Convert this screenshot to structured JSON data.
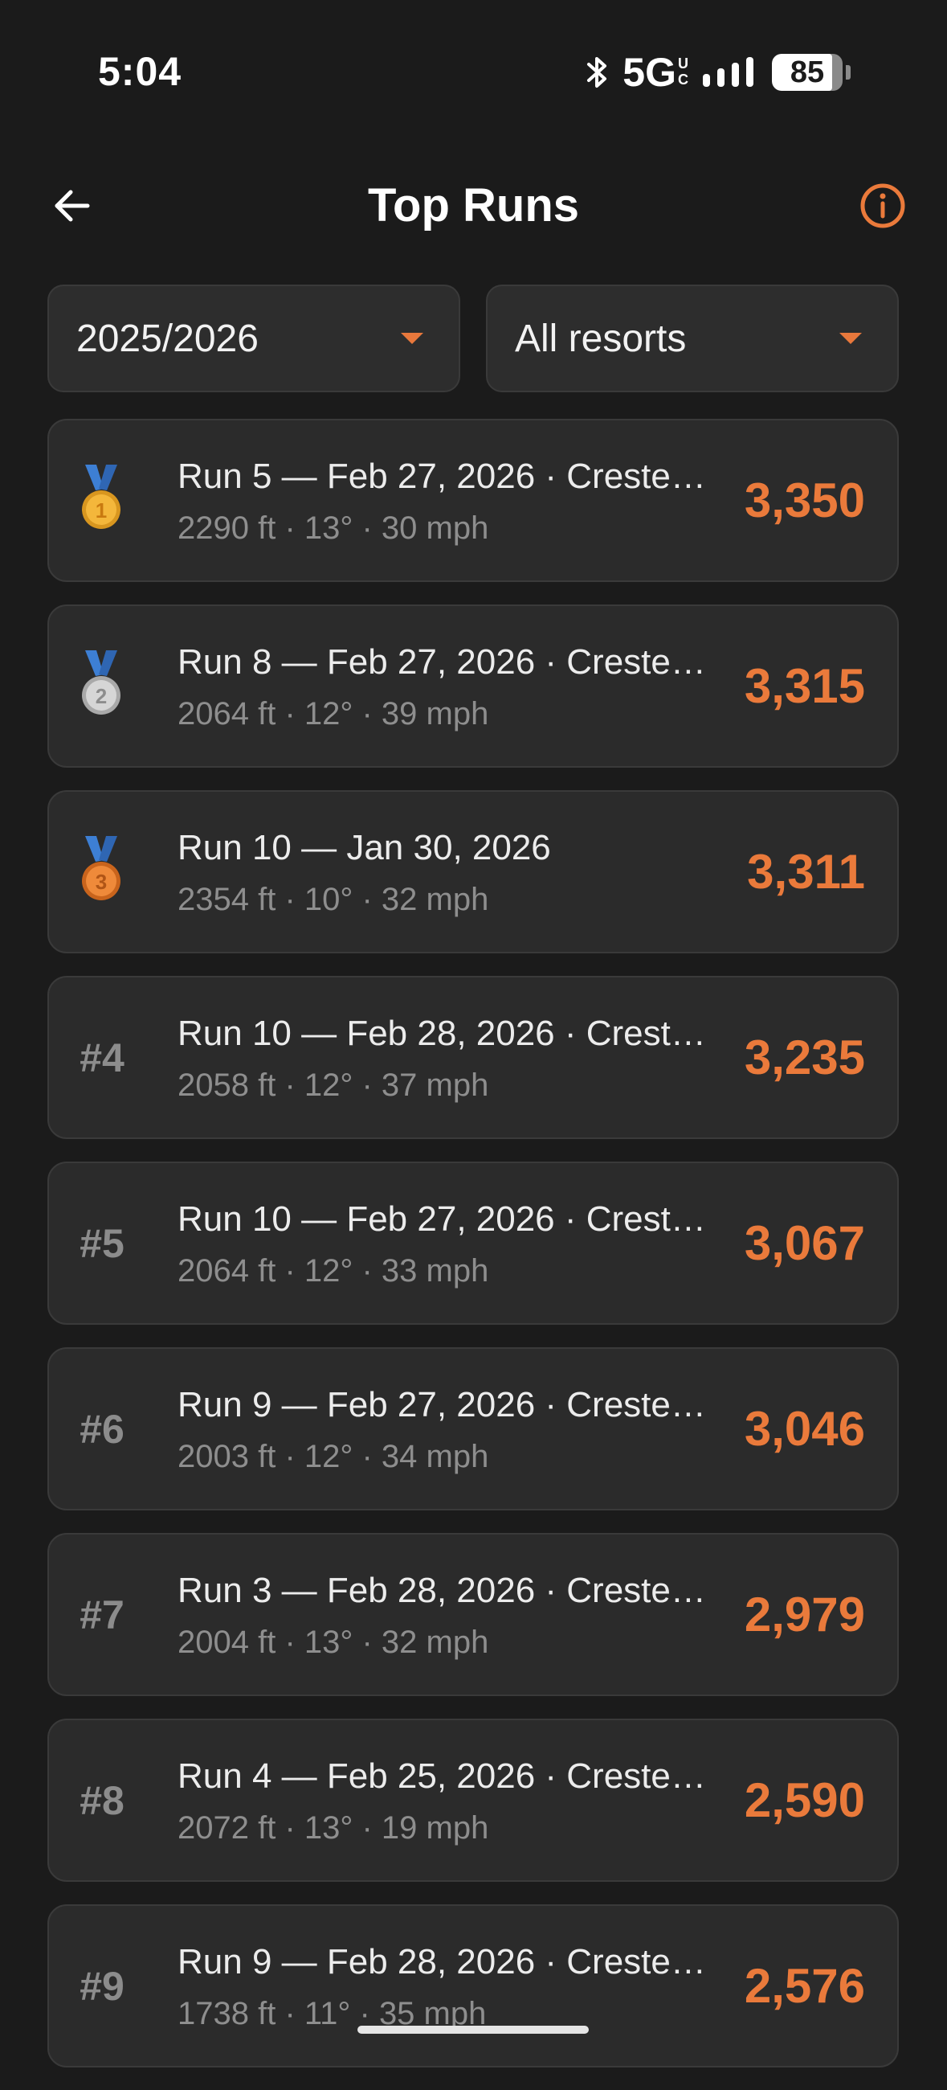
{
  "status_bar": {
    "time": "5:04",
    "network": "5G",
    "network_suffix_top": "U",
    "network_suffix_bottom": "C",
    "battery_level": "85",
    "battery_fraction": 0.85
  },
  "header": {
    "title": "Top Runs",
    "back_icon": "arrow-left-icon",
    "info_icon": "info-circle-icon"
  },
  "filters": {
    "season": "2025/2026",
    "resort": "All resorts"
  },
  "colors": {
    "accent": "#ea7a3b",
    "background": "#1b1b1b",
    "card": "#2b2b2b"
  },
  "runs": [
    {
      "rank": "#1",
      "medal": "gold",
      "medal_number": "1",
      "title": "Run 5 — Feb 27, 2026 · Creste…",
      "stats": "2290 ft · 13° · 30 mph",
      "score": "3,350"
    },
    {
      "rank": "#2",
      "medal": "silver",
      "medal_number": "2",
      "title": "Run 8 — Feb 27, 2026 · Creste…",
      "stats": "2064 ft · 12° · 39 mph",
      "score": "3,315"
    },
    {
      "rank": "#3",
      "medal": "bronze",
      "medal_number": "3",
      "title": "Run 10 — Jan 30, 2026",
      "stats": "2354 ft · 10° · 32 mph",
      "score": "3,311"
    },
    {
      "rank": "#4",
      "medal": null,
      "title": "Run 10 — Feb 28, 2026 · Crest…",
      "stats": "2058 ft · 12° · 37 mph",
      "score": "3,235"
    },
    {
      "rank": "#5",
      "medal": null,
      "title": "Run 10 — Feb 27, 2026 · Crest…",
      "stats": "2064 ft · 12° · 33 mph",
      "score": "3,067"
    },
    {
      "rank": "#6",
      "medal": null,
      "title": "Run 9 — Feb 27, 2026 · Creste…",
      "stats": "2003 ft · 12° · 34 mph",
      "score": "3,046"
    },
    {
      "rank": "#7",
      "medal": null,
      "title": "Run 3 — Feb 28, 2026 · Creste…",
      "stats": "2004 ft · 13° · 32 mph",
      "score": "2,979"
    },
    {
      "rank": "#8",
      "medal": null,
      "title": "Run 4 — Feb 25, 2026 · Creste…",
      "stats": "2072 ft · 13° · 19 mph",
      "score": "2,590"
    },
    {
      "rank": "#9",
      "medal": null,
      "title": "Run 9 — Feb 28, 2026 · Creste…",
      "stats": "1738 ft · 11° · 35 mph",
      "score": "2,576"
    }
  ]
}
